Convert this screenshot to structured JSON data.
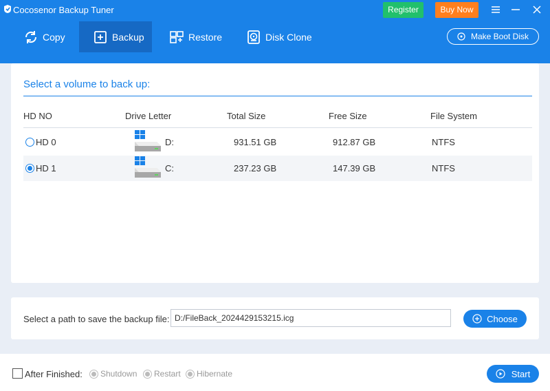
{
  "app": {
    "title": "Cocosenor Backup Tuner"
  },
  "titlebar": {
    "register_label": "Register",
    "buynow_label": "Buy Now"
  },
  "tabs": [
    {
      "label": "Copy",
      "icon": "copy-icon"
    },
    {
      "label": "Backup",
      "icon": "backup-icon",
      "active": true
    },
    {
      "label": "Restore",
      "icon": "restore-icon"
    },
    {
      "label": "Disk Clone",
      "icon": "disk-clone-icon"
    }
  ],
  "toolbar": {
    "boot_disk_label": "Make Boot Disk"
  },
  "volume": {
    "title": "Select a volume to back up:",
    "columns": [
      "HD NO",
      "Drive Letter",
      "Total Size",
      "Free Size",
      "File System"
    ],
    "rows": [
      {
        "hd": "HD 0",
        "letter": "D:",
        "total": "931.51 GB",
        "free": "912.87 GB",
        "fs": "NTFS",
        "selected": false
      },
      {
        "hd": "HD 1",
        "letter": "C:",
        "total": "237.23 GB",
        "free": "147.39 GB",
        "fs": "NTFS",
        "selected": true
      }
    ]
  },
  "path": {
    "label": "Select a path to save the backup file:",
    "value": "D:/FileBack_2024429153215.icg",
    "choose_label": "Choose"
  },
  "footer": {
    "after_label": "After Finished:",
    "options": [
      "Shutdown",
      "Restart",
      "Hibernate"
    ],
    "start_label": "Start"
  },
  "colors": {
    "primary": "#1a82e8",
    "active_tab": "#1669c4",
    "register": "#21c06c",
    "buynow": "#ff7f1e"
  }
}
